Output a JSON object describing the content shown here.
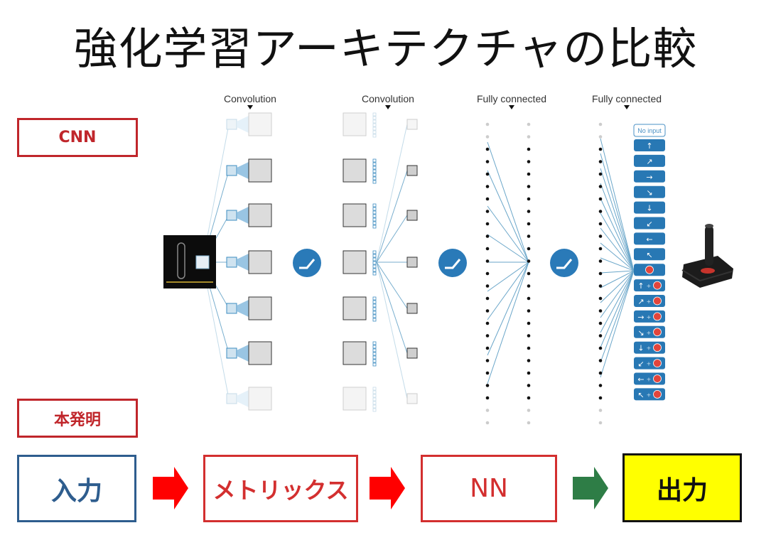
{
  "title": "強化学習アーキテクチャの比較",
  "cnn_label": "CNN",
  "invention_label": "本発明",
  "diagram": {
    "layer_labels": [
      "Convolution",
      "Convolution",
      "Fully connected",
      "Fully connected"
    ],
    "no_input_label": "No input",
    "action_glyphs": [
      "↑",
      "↗",
      "→",
      "↘",
      "↓",
      "↙",
      "←",
      "↖",
      "●",
      "↑+●",
      "↗+●",
      "→+●",
      "↘+●",
      "↓+●",
      "↙+●",
      "←+●",
      "↖+●"
    ]
  },
  "flow": {
    "input": "入力",
    "matrix": "メトリックス",
    "nn": "NN",
    "output": "出力"
  },
  "colors": {
    "tag_red": "#c0262b",
    "input_blue": "#2e5d8e",
    "arrow_red": "#ff0000",
    "arrow_green": "#2e7d46",
    "output_yellow": "#ffff00",
    "relu_blue": "#2a7ab8"
  }
}
